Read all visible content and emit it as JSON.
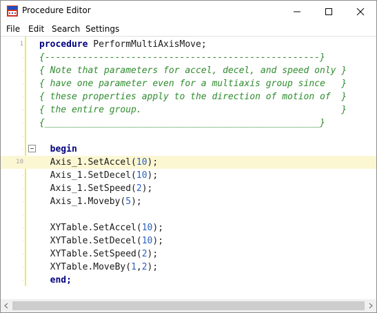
{
  "window": {
    "title": "Procedure Editor"
  },
  "menu": {
    "items": [
      "File",
      "Edit",
      "Search",
      "Settings"
    ]
  },
  "editor": {
    "lines": [
      {
        "no": "1",
        "tokens": [
          [
            "kw",
            "procedure"
          ],
          [
            "ident",
            " PerformMultiAxisMove;"
          ]
        ]
      },
      {
        "no": "",
        "tokens": [
          [
            "cm",
            "{---------------------------------------------------}"
          ]
        ]
      },
      {
        "no": "",
        "tokens": [
          [
            "cm",
            "{ Note that parameters for accel, decel, and speed only }"
          ]
        ]
      },
      {
        "no": "",
        "tokens": [
          [
            "cm",
            "{ have one parameter even for a multiaxis group since   }"
          ]
        ]
      },
      {
        "no": "",
        "tokens": [
          [
            "cm",
            "{ these properties apply to the direction of motion of  }"
          ]
        ]
      },
      {
        "no": "",
        "tokens": [
          [
            "cm",
            "{ the entire group.                                     }"
          ]
        ]
      },
      {
        "no": "",
        "tokens": [
          [
            "cm",
            "{___________________________________________________}"
          ]
        ]
      },
      {
        "no": "",
        "tokens": []
      },
      {
        "no": "",
        "fold": true,
        "tokens": [
          [
            "kw",
            "  begin"
          ]
        ]
      },
      {
        "no": "10",
        "highlight": true,
        "tokens": [
          [
            "ident",
            "  Axis_1.SetAccel("
          ],
          [
            "num",
            "10"
          ],
          [
            "ident",
            ");"
          ]
        ]
      },
      {
        "no": "",
        "tokens": [
          [
            "ident",
            "  Axis_1.SetDecel("
          ],
          [
            "num",
            "10"
          ],
          [
            "ident",
            ");"
          ]
        ]
      },
      {
        "no": "",
        "tokens": [
          [
            "ident",
            "  Axis_1.SetSpeed("
          ],
          [
            "num",
            "2"
          ],
          [
            "ident",
            ");"
          ]
        ]
      },
      {
        "no": "",
        "tokens": [
          [
            "ident",
            "  Axis_1.Moveby("
          ],
          [
            "num",
            "5"
          ],
          [
            "ident",
            ");"
          ]
        ]
      },
      {
        "no": "",
        "tokens": []
      },
      {
        "no": "",
        "tokens": [
          [
            "ident",
            "  XYTable.SetAccel("
          ],
          [
            "num",
            "10"
          ],
          [
            "ident",
            ");"
          ]
        ]
      },
      {
        "no": "",
        "tokens": [
          [
            "ident",
            "  XYTable.SetDecel("
          ],
          [
            "num",
            "10"
          ],
          [
            "ident",
            ");"
          ]
        ]
      },
      {
        "no": "",
        "tokens": [
          [
            "ident",
            "  XYTable.SetSpeed("
          ],
          [
            "num",
            "2"
          ],
          [
            "ident",
            ");"
          ]
        ]
      },
      {
        "no": "",
        "tokens": [
          [
            "ident",
            "  XYTable.MoveBy("
          ],
          [
            "num",
            "1"
          ],
          [
            "ident",
            ","
          ],
          [
            "num",
            "2"
          ],
          [
            "ident",
            ");"
          ]
        ]
      },
      {
        "no": "",
        "tokens": [
          [
            "kw",
            "  end;"
          ]
        ]
      }
    ]
  }
}
